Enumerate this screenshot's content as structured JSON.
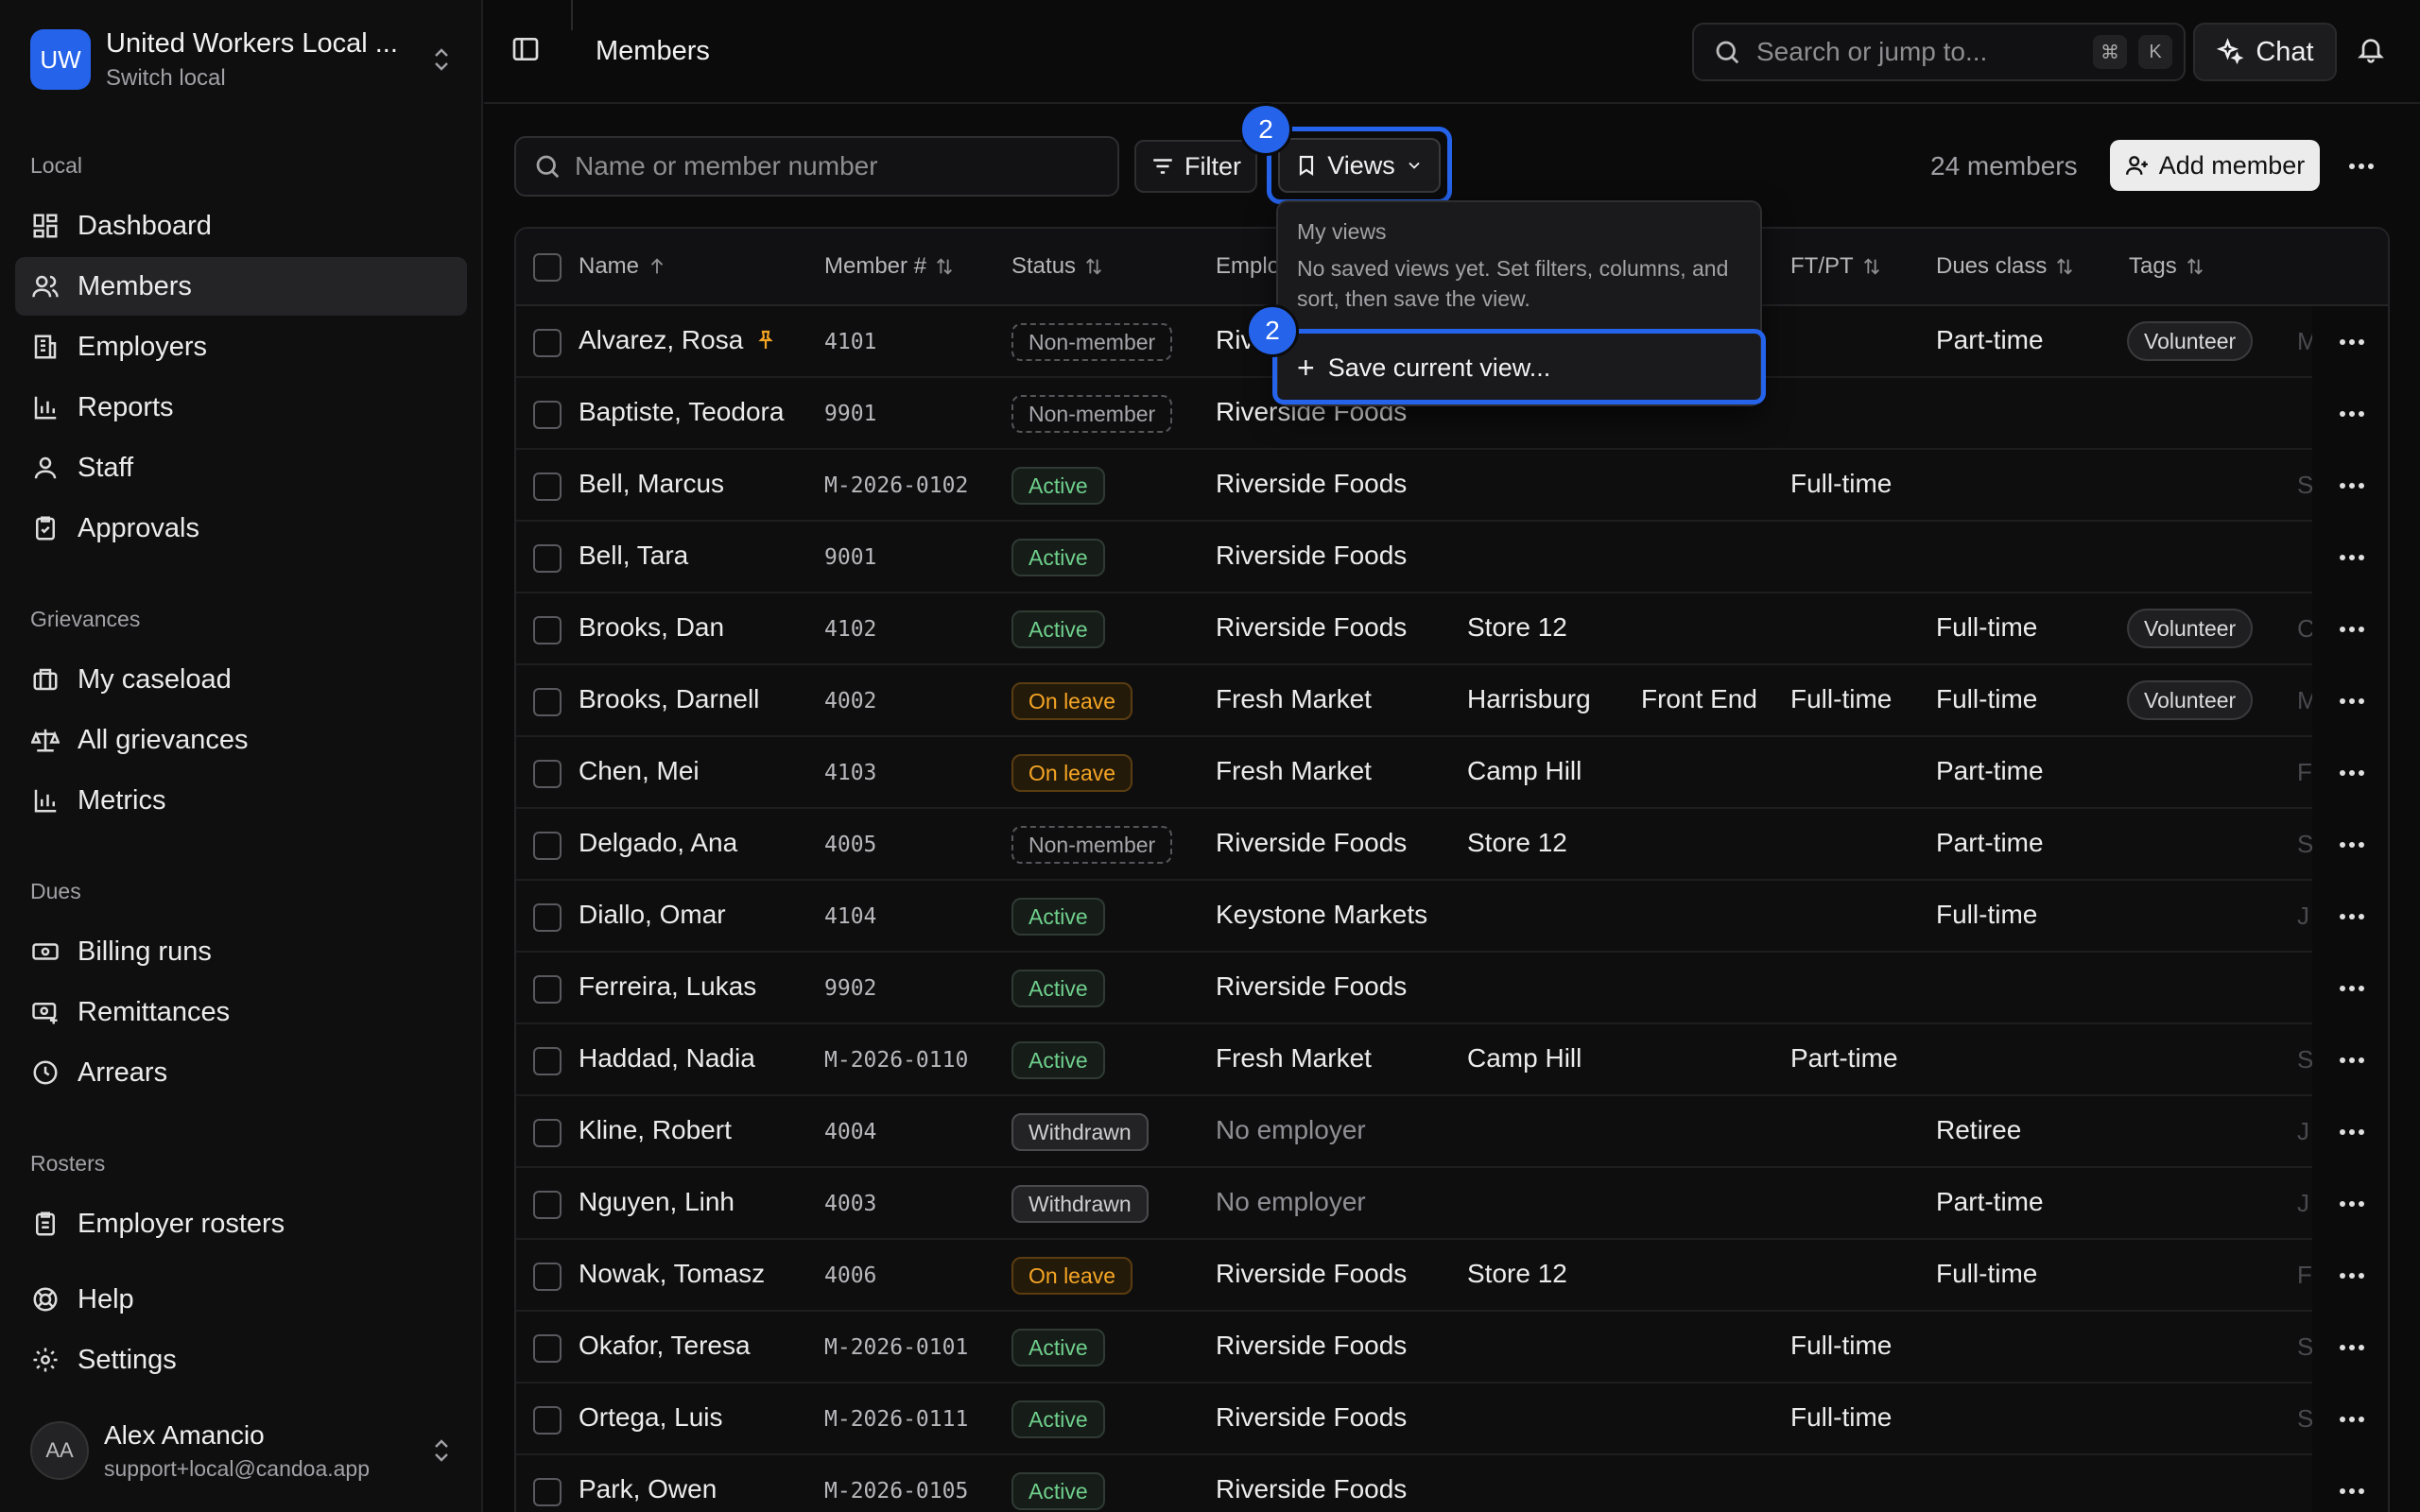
{
  "org": {
    "initials": "UW",
    "name": "United Workers Local ...",
    "sub": "Switch local"
  },
  "sections": {
    "local": "Local",
    "grievances": "Grievances",
    "dues": "Dues",
    "rosters": "Rosters"
  },
  "nav": {
    "dashboard": "Dashboard",
    "members": "Members",
    "employers": "Employers",
    "reports": "Reports",
    "staff": "Staff",
    "approvals": "Approvals",
    "my_caseload": "My caseload",
    "all_grievances": "All grievances",
    "metrics": "Metrics",
    "billing_runs": "Billing runs",
    "remittances": "Remittances",
    "arrears": "Arrears",
    "employer_rosters": "Employer rosters",
    "help": "Help",
    "settings": "Settings"
  },
  "user": {
    "initials": "AA",
    "name": "Alex Amancio",
    "email": "support+local@candoa.app"
  },
  "topbar": {
    "title": "Members",
    "search_placeholder": "Search or jump to...",
    "kbd_cmd": "⌘",
    "kbd_k": "K",
    "chat": "Chat"
  },
  "toolbar": {
    "name_search_placeholder": "Name or member number",
    "filter": "Filter",
    "views": "Views",
    "badge": "2",
    "count": "24 members",
    "add_member": "Add member"
  },
  "dropdown": {
    "title": "My views",
    "desc": "No saved views yet. Set filters, columns, and sort, then save the view.",
    "save": "Save current view...",
    "badge": "2"
  },
  "columns": {
    "name": "Name",
    "member_no": "Member #",
    "status": "Status",
    "employer": "Emplo",
    "ftpt": "FT/PT",
    "dues_class": "Dues class",
    "tags": "Tags"
  },
  "rows": [
    {
      "name": "Alvarez, Rosa",
      "num": "4101",
      "status": "Non-member",
      "statusType": "nonmember",
      "employer": "Riv",
      "location": "",
      "dept": "",
      "ftpt": "",
      "dues": "Part-time",
      "tag": "Volunteer",
      "trunc": "M",
      "pinned": true
    },
    {
      "name": "Baptiste, Teodora",
      "num": "9901",
      "status": "Non-member",
      "statusType": "nonmember",
      "employer": "Riverside Foods",
      "location": "",
      "dept": "",
      "ftpt": "",
      "dues": "",
      "tag": "",
      "trunc": ""
    },
    {
      "name": "Bell, Marcus",
      "num": "M-2026-0102",
      "status": "Active",
      "statusType": "active",
      "employer": "Riverside Foods",
      "location": "",
      "dept": "",
      "ftpt": "Full-time",
      "dues": "",
      "tag": "",
      "trunc": "S"
    },
    {
      "name": "Bell, Tara",
      "num": "9001",
      "status": "Active",
      "statusType": "active",
      "employer": "Riverside Foods",
      "location": "",
      "dept": "",
      "ftpt": "",
      "dues": "",
      "tag": "",
      "trunc": ""
    },
    {
      "name": "Brooks, Dan",
      "num": "4102",
      "status": "Active",
      "statusType": "active",
      "employer": "Riverside Foods",
      "location": "Store 12",
      "dept": "",
      "ftpt": "",
      "dues": "Full-time",
      "tag": "Volunteer",
      "trunc": "C"
    },
    {
      "name": "Brooks, Darnell",
      "num": "4002",
      "status": "On leave",
      "statusType": "onleave",
      "employer": "Fresh Market",
      "location": "Harrisburg",
      "dept": "Front End",
      "ftpt": "Full-time",
      "dues": "Full-time",
      "tag": "Volunteer",
      "trunc": "M"
    },
    {
      "name": "Chen, Mei",
      "num": "4103",
      "status": "On leave",
      "statusType": "onleave",
      "employer": "Fresh Market",
      "location": "Camp Hill",
      "dept": "",
      "ftpt": "",
      "dues": "Part-time",
      "tag": "",
      "trunc": "F"
    },
    {
      "name": "Delgado, Ana",
      "num": "4005",
      "status": "Non-member",
      "statusType": "nonmember",
      "employer": "Riverside Foods",
      "location": "Store 12",
      "dept": "",
      "ftpt": "",
      "dues": "Part-time",
      "tag": "",
      "trunc": "S"
    },
    {
      "name": "Diallo, Omar",
      "num": "4104",
      "status": "Active",
      "statusType": "active",
      "employer": "Keystone Markets",
      "location": "",
      "dept": "",
      "ftpt": "",
      "dues": "Full-time",
      "tag": "",
      "trunc": "J"
    },
    {
      "name": "Ferreira, Lukas",
      "num": "9902",
      "status": "Active",
      "statusType": "active",
      "employer": "Riverside Foods",
      "location": "",
      "dept": "",
      "ftpt": "",
      "dues": "",
      "tag": "",
      "trunc": ""
    },
    {
      "name": "Haddad, Nadia",
      "num": "M-2026-0110",
      "status": "Active",
      "statusType": "active",
      "employer": "Fresh Market",
      "location": "Camp Hill",
      "dept": "",
      "ftpt": "Part-time",
      "dues": "",
      "tag": "",
      "trunc": "S"
    },
    {
      "name": "Kline, Robert",
      "num": "4004",
      "status": "Withdrawn",
      "statusType": "withdrawn",
      "employer": "No employer",
      "location": "",
      "dept": "",
      "ftpt": "",
      "dues": "Retiree",
      "tag": "",
      "trunc": "J",
      "muted": true
    },
    {
      "name": "Nguyen, Linh",
      "num": "4003",
      "status": "Withdrawn",
      "statusType": "withdrawn",
      "employer": "No employer",
      "location": "",
      "dept": "",
      "ftpt": "",
      "dues": "Part-time",
      "tag": "",
      "trunc": "J",
      "muted": true
    },
    {
      "name": "Nowak, Tomasz",
      "num": "4006",
      "status": "On leave",
      "statusType": "onleave",
      "employer": "Riverside Foods",
      "location": "Store 12",
      "dept": "",
      "ftpt": "",
      "dues": "Full-time",
      "tag": "",
      "trunc": "F"
    },
    {
      "name": "Okafor, Teresa",
      "num": "M-2026-0101",
      "status": "Active",
      "statusType": "active",
      "employer": "Riverside Foods",
      "location": "",
      "dept": "",
      "ftpt": "Full-time",
      "dues": "",
      "tag": "",
      "trunc": "S"
    },
    {
      "name": "Ortega, Luis",
      "num": "M-2026-0111",
      "status": "Active",
      "statusType": "active",
      "employer": "Riverside Foods",
      "location": "",
      "dept": "",
      "ftpt": "Full-time",
      "dues": "",
      "tag": "",
      "trunc": "S"
    },
    {
      "name": "Park, Owen",
      "num": "M-2026-0105",
      "status": "Active",
      "statusType": "active",
      "employer": "Riverside Foods",
      "location": "",
      "dept": "",
      "ftpt": "",
      "dues": "",
      "tag": "",
      "trunc": ""
    }
  ]
}
